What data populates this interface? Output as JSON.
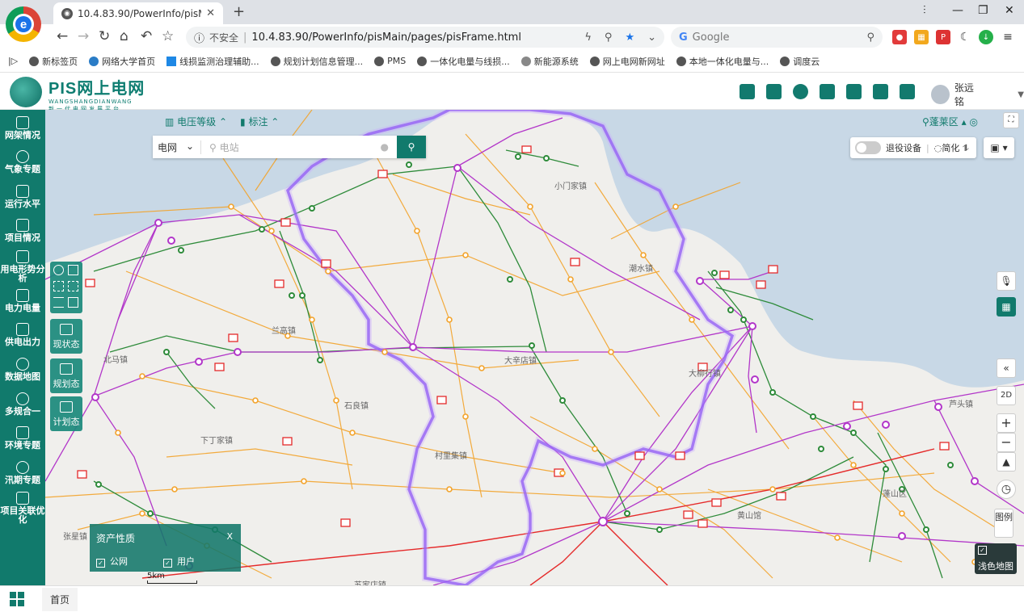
{
  "browser": {
    "tab_title": "10.4.83.90/PowerInfo/pisMain/",
    "insecure_label": "不安全",
    "url": "10.4.83.90/PowerInfo/pisMain/pages/pisFrame.html",
    "search_engine": "Google",
    "bookmarks": [
      "新标签页",
      "网络大学首页",
      "线损监测治理辅助...",
      "规划计划信息管理...",
      "PMS",
      "一体化电量与线损...",
      "新能源系统",
      "网上电网新网址",
      "本地一体化电量与...",
      "调度云"
    ]
  },
  "app": {
    "logo_main": "PIS网上电网",
    "logo_sub1": "WANGSHANGDIANWANG",
    "logo_sub2": "新一代电网发展平台",
    "user_name": "张远铭"
  },
  "sidebar": {
    "items": [
      "网架情况",
      "气象专题",
      "运行水平",
      "项目情况",
      "用电形势分析",
      "电力电量",
      "供电出力",
      "数据地图",
      "多规合一",
      "环境专题",
      "汛期专题",
      "项目关联优化"
    ]
  },
  "toolbar": {
    "voltage_level": "电压等级",
    "annotation": "标注",
    "region": "蓬莱区",
    "search_type": "电网",
    "search_placeholder": "电站",
    "retire_label": "退役设备",
    "simplify_label": "简化"
  },
  "tools": {
    "current_state": "现状态",
    "planning_state": "规划态",
    "plan_state": "计划态"
  },
  "map_controls": {
    "mode_2d": "2D",
    "legend": "图例",
    "basemap": "浅色地图",
    "scale": "5km"
  },
  "asset_panel": {
    "title": "资产性质",
    "close": "X",
    "items": [
      "公网",
      "用户"
    ]
  },
  "places": [
    "兰高镇",
    "北马镇",
    "下丁家镇",
    "石良镇",
    "村里集镇",
    "大辛店镇",
    "小门家镇",
    "潮水镇",
    "大柳行镇",
    "黄山馆",
    "芦头镇",
    "苏家店镇",
    "张星镇",
    "蓬山区"
  ],
  "footer": {
    "home_tab": "首页"
  },
  "colors": {
    "brand": "#117a6c",
    "line_500kv": "#e52a2a",
    "line_220kv": "#b236c9",
    "line_110kv": "#2e8b3a",
    "line_35kv": "#f3a32a",
    "boundary": "#7a3cf0"
  }
}
